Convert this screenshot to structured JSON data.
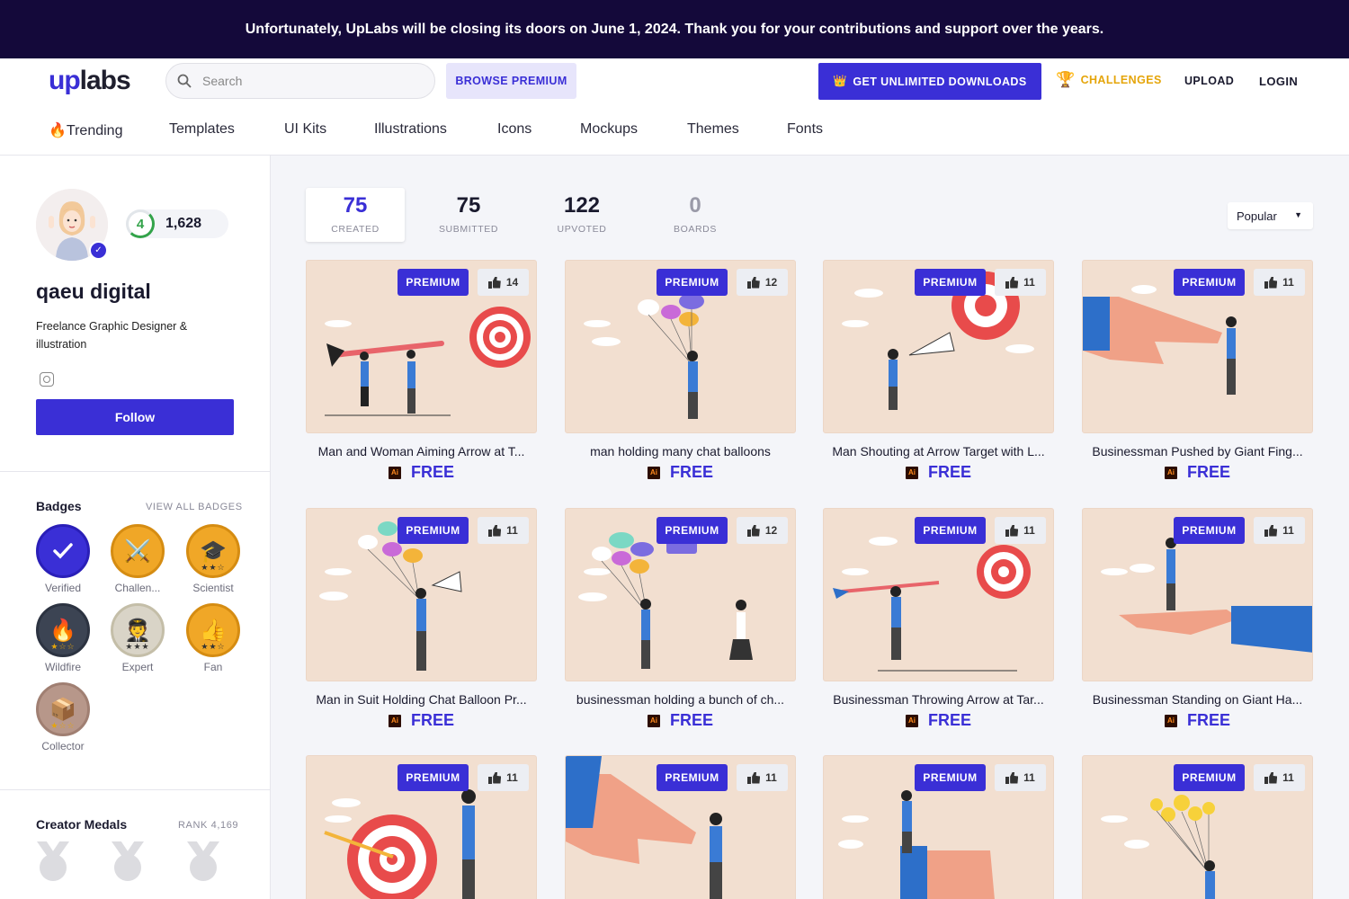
{
  "banner": {
    "text": "Unfortunately, UpLabs will be closing its doors on June 1, 2024. Thank you for your contributions and support over the years."
  },
  "header": {
    "logo_up": "up",
    "logo_labs": "labs",
    "search_placeholder": "Search",
    "browse_premium": "BROWSE PREMIUM",
    "unlimited": "GET UNLIMITED DOWNLOADS",
    "challenges": "CHALLENGES",
    "upload": "UPLOAD",
    "login": "LOGIN",
    "accent": "#3a2fd6"
  },
  "nav": {
    "items": [
      "Trending",
      "Templates",
      "UI Kits",
      "Illustrations",
      "Icons",
      "Mockups",
      "Themes",
      "Fonts"
    ]
  },
  "profile": {
    "level": "4",
    "points": "1,628",
    "name": "qaeu digital",
    "bio": "Freelance Graphic Designer & illustration",
    "follow": "Follow"
  },
  "badges": {
    "title": "Badges",
    "view_all": "VIEW ALL BADGES",
    "items": [
      "Verified",
      "Challen...",
      "Scientist",
      "Wildfire",
      "Expert",
      "Fan",
      "Collector"
    ]
  },
  "medals": {
    "title": "Creator Medals",
    "rank": "RANK 4,169"
  },
  "stats": [
    {
      "value": "75",
      "label": "CREATED"
    },
    {
      "value": "75",
      "label": "SUBMITTED"
    },
    {
      "value": "122",
      "label": "UPVOTED"
    },
    {
      "value": "0",
      "label": "BOARDS"
    }
  ],
  "sort": {
    "selected": "Popular"
  },
  "cards": [
    {
      "title": "Man and Woman Aiming Arrow at T...",
      "likes": "14",
      "tag": "PREMIUM",
      "price": "FREE"
    },
    {
      "title": "man holding many chat balloons",
      "likes": "12",
      "tag": "PREMIUM",
      "price": "FREE"
    },
    {
      "title": "Man Shouting at Arrow Target with L...",
      "likes": "11",
      "tag": "PREMIUM",
      "price": "FREE"
    },
    {
      "title": "Businessman Pushed by Giant Fing...",
      "likes": "11",
      "tag": "PREMIUM",
      "price": "FREE"
    },
    {
      "title": "Man in Suit Holding Chat Balloon Pr...",
      "likes": "11",
      "tag": "PREMIUM",
      "price": "FREE"
    },
    {
      "title": "businessman holding a bunch of ch...",
      "likes": "12",
      "tag": "PREMIUM",
      "price": "FREE"
    },
    {
      "title": "Businessman Throwing Arrow at Tar...",
      "likes": "11",
      "tag": "PREMIUM",
      "price": "FREE"
    },
    {
      "title": "Businessman Standing on Giant Ha...",
      "likes": "11",
      "tag": "PREMIUM",
      "price": "FREE"
    },
    {
      "title": "",
      "likes": "11",
      "tag": "PREMIUM",
      "price": ""
    },
    {
      "title": "",
      "likes": "11",
      "tag": "PREMIUM",
      "price": ""
    },
    {
      "title": "",
      "likes": "11",
      "tag": "PREMIUM",
      "price": ""
    },
    {
      "title": "",
      "likes": "11",
      "tag": "PREMIUM",
      "price": ""
    }
  ]
}
